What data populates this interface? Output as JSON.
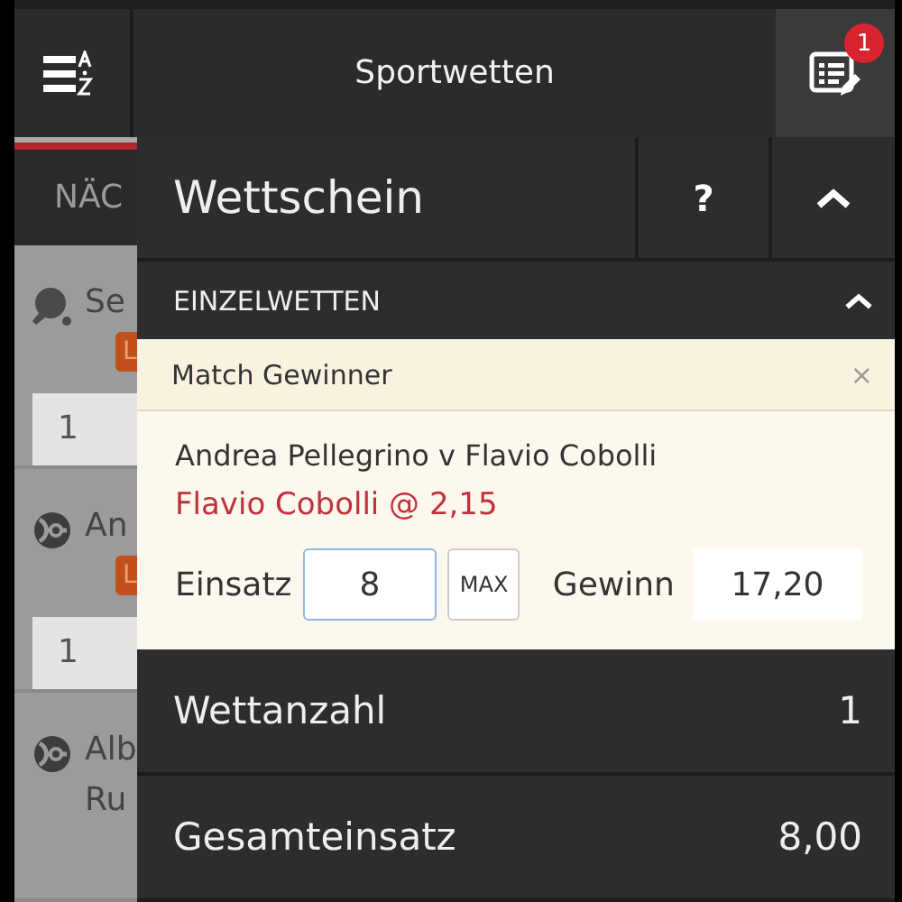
{
  "header": {
    "title": "Sportwetten",
    "badge": "1"
  },
  "background": {
    "tab": "NÄC",
    "events": [
      {
        "kind": "table-tennis",
        "name": "Se",
        "badge": "L",
        "odds": "1"
      },
      {
        "kind": "tennis",
        "name": "An",
        "badge": "L",
        "odds": "1"
      },
      {
        "kind": "tennis",
        "name": "Alb",
        "name_line_2": "Ru"
      }
    ]
  },
  "slip": {
    "title": "Wettschein",
    "help": "?",
    "section": "EINZELWETTEN",
    "bet": {
      "market": "Match Gewinner",
      "close": "×",
      "match": "Andrea Pellegrino v Flavio Cobolli",
      "selection": "Flavio Cobolli @ 2,15",
      "stake_label": "Einsatz",
      "stake": "8",
      "max": "MAX",
      "win_label": "Gewinn",
      "win": "17,20"
    },
    "summary": [
      {
        "label": "Wettanzahl",
        "value": "1"
      },
      {
        "label": "Gesamteinsatz",
        "value": "8,00"
      }
    ]
  }
}
